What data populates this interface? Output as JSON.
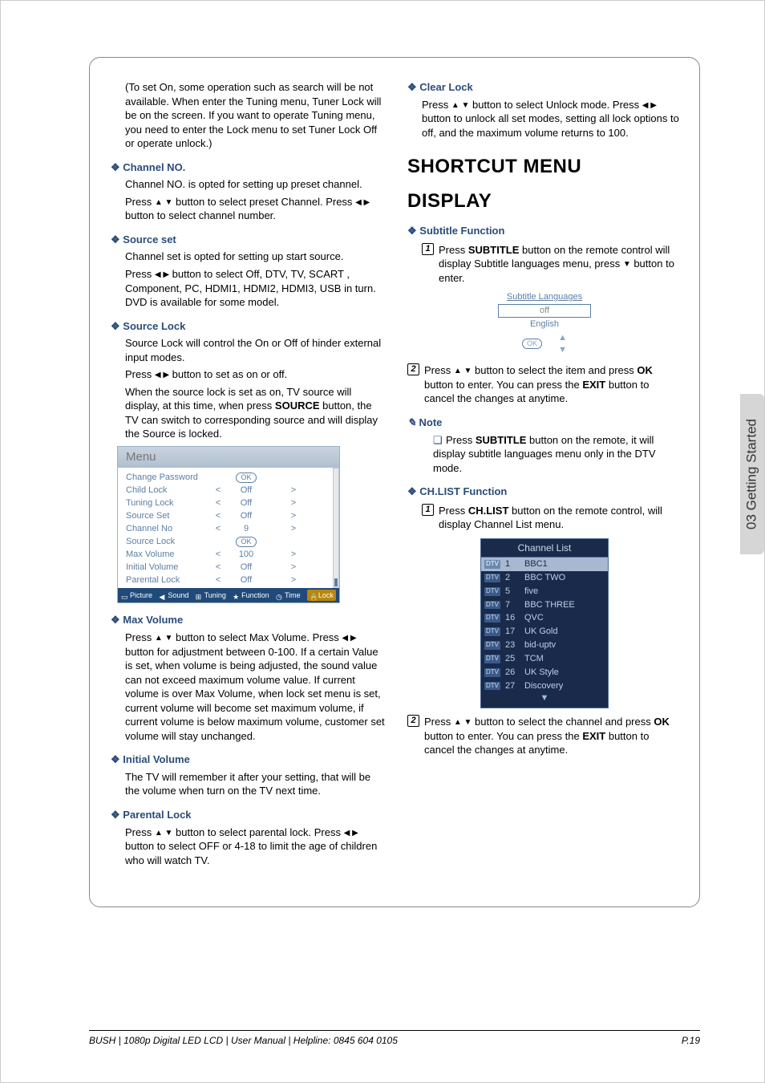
{
  "side_tab": "03 Getting Started",
  "footer_left": "BUSH  | 1080p  Digital LED LCD | User Manual | Helpline: 0845 604 0105",
  "footer_right": "P.19",
  "left": {
    "intro": "(To set On, some operation such as search will be not available. When enter the Tuning menu, Tuner Lock will be on the screen. If you want to operate Tuning menu, you need to enter the Lock menu to set Tuner Lock Off or operate unlock.)",
    "channel_no_h": "Channel NO.",
    "channel_no_1": "Channel NO. is opted for setting up preset channel.",
    "channel_no_2a": "Press ",
    "channel_no_2b": " button to select preset Channel. Press ",
    "channel_no_2c": " button to select channel number.",
    "source_set_h": "Source set",
    "source_set_1": "Channel set is opted for setting up start source.",
    "source_set_2a": "Press ",
    "source_set_2b": " button to select Off, DTV, TV,  SCART , Component, PC, HDMI1, HDMI2, HDMI3, USB in turn. DVD is available for some model.",
    "source_lock_h": "Source Lock",
    "source_lock_1": "Source Lock will control the On or Off of hinder external input modes.",
    "source_lock_2a": "Press ",
    "source_lock_2b": " button to set as on or off.",
    "source_lock_3a": "When the source lock is set as on, TV source will display, at this time, when press ",
    "source_lock_3b": "SOURCE",
    "source_lock_3c": " button, the TV can switch to corresponding source and will display the Source is locked.",
    "max_vol_h": "Max Volume",
    "max_vol_a": "Press ",
    "max_vol_b": " button to select Max Volume. Press ",
    "max_vol_c": " button for adjustment between 0-100. If a certain Value is set, when volume is being adjusted, the sound value can not exceed maximum volume value. If current volume is over Max Volume, when lock set menu is set, current volume will become set maximum volume, if current volume is below maximum volume, customer set volume will stay unchanged.",
    "init_vol_h": "Initial Volume",
    "init_vol_1": "The TV will remember it after your setting, that will be the volume when turn on the TV next time.",
    "parental_h": "Parental Lock",
    "parental_a": "Press ",
    "parental_b": " button to select parental lock. Press ",
    "parental_c": " button to select OFF or 4-18 to limit the age of children who will watch TV."
  },
  "osd": {
    "title": "Menu",
    "rows": [
      {
        "lbl": "Change Password",
        "lt": "",
        "val_ok": true,
        "val": "",
        "gt": ""
      },
      {
        "lbl": "Child Lock",
        "lt": "<",
        "val": "Off",
        "gt": ">"
      },
      {
        "lbl": "Tuning Lock",
        "lt": "<",
        "val": "Off",
        "gt": ">"
      },
      {
        "lbl": "Source Set",
        "lt": "<",
        "val": "Off",
        "gt": ">"
      },
      {
        "lbl": "Channel No",
        "lt": "<",
        "val": "9",
        "gt": ">"
      },
      {
        "lbl": "Source Lock",
        "lt": "",
        "val_ok": true,
        "val": "",
        "gt": ""
      },
      {
        "lbl": "Max Volume",
        "lt": "<",
        "val": "100",
        "gt": ">"
      },
      {
        "lbl": "Initial Volume",
        "lt": "<",
        "val": "Off",
        "gt": ">"
      },
      {
        "lbl": "Parental Lock",
        "lt": "<",
        "val": "Off",
        "gt": ">"
      }
    ],
    "tabs": [
      "Picture",
      "Sound",
      "Tuning",
      "Function",
      "Time",
      "Lock"
    ]
  },
  "right": {
    "clear_h": "Clear Lock",
    "clear_a": "Press ",
    "clear_b": " button to select Unlock mode. Press ",
    "clear_c": " button to unlock all set modes, setting all lock options to off, and the maximum volume returns to 100.",
    "shortcut_h1": "SHORTCUT MENU",
    "display_h1": "DISPLAY",
    "subtitle_h": "Subtitle Function",
    "sub_1a": "Press ",
    "sub_1b": "SUBTITLE",
    "sub_1c": " button on the remote control will display Subtitle languages menu, press ",
    "sub_1d": " button to enter.",
    "subt_title": "Subtitle Languages",
    "subt_off": "off",
    "subt_eng": "English",
    "subt_ok": "OK",
    "sub_2a": "Press ",
    "sub_2b": " button to select the item and press ",
    "sub_2c": "OK",
    "sub_2d": " button to enter. You can press the ",
    "sub_2e": "EXIT",
    "sub_2f": " button to cancel the changes at anytime.",
    "note_h": "Note",
    "note_a": "Press ",
    "note_b": "SUBTITLE",
    "note_c": " button on the remote, it will display subtitle languages menu only in the DTV mode.",
    "chlist_h": "CH.LIST Function",
    "ch_1a": "Press ",
    "ch_1b": "CH.LIST",
    "ch_1c": " button on the remote control, will display Channel List menu.",
    "chlist_title": "Channel List",
    "channels": [
      {
        "n": "1",
        "name": "BBC1",
        "sel": true
      },
      {
        "n": "2",
        "name": "BBC TWO"
      },
      {
        "n": "5",
        "name": "five"
      },
      {
        "n": "7",
        "name": "BBC THREE"
      },
      {
        "n": "16",
        "name": "QVC"
      },
      {
        "n": "17",
        "name": "UK Gold"
      },
      {
        "n": "23",
        "name": "bid-uptv"
      },
      {
        "n": "25",
        "name": "TCM"
      },
      {
        "n": "26",
        "name": "UK Style"
      },
      {
        "n": "27",
        "name": "Discovery"
      }
    ],
    "ch_2a": "Press ",
    "ch_2b": " button to select the channel and press ",
    "ch_2c": "OK",
    "ch_2d": " button to enter. You can press the ",
    "ch_2e": "EXIT",
    "ch_2f": " button to cancel the changes at anytime."
  }
}
